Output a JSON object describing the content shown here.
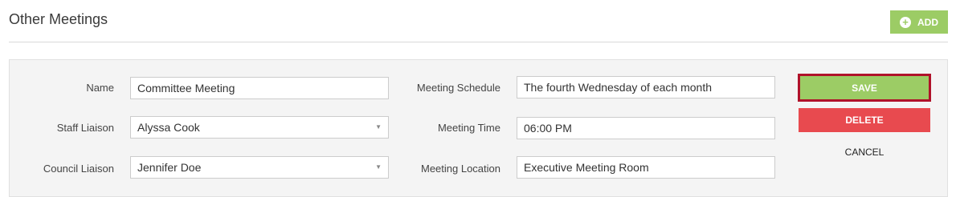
{
  "header": {
    "title": "Other Meetings",
    "add_label": "ADD",
    "add_icon": "plus-circle-icon"
  },
  "form": {
    "name_label": "Name",
    "name_value": "Committee Meeting",
    "staff_liaison_label": "Staff Liaison",
    "staff_liaison_value": "Alyssa Cook",
    "council_liaison_label": "Council Liaison",
    "council_liaison_value": "Jennifer Doe",
    "schedule_label": "Meeting Schedule",
    "schedule_value": "The fourth Wednesday of each month",
    "time_label": "Meeting Time",
    "time_value": "06:00 PM",
    "location_label": "Meeting Location",
    "location_value": "Executive Meeting Room",
    "dropdown_icon": "chevron-down-icon"
  },
  "actions": {
    "save_label": "SAVE",
    "delete_label": "DELETE",
    "cancel_label": "CANCEL"
  },
  "colors": {
    "accent_green": "#9ccc65",
    "delete_red": "#e84a4f",
    "focus_outline": "#b0122a"
  }
}
